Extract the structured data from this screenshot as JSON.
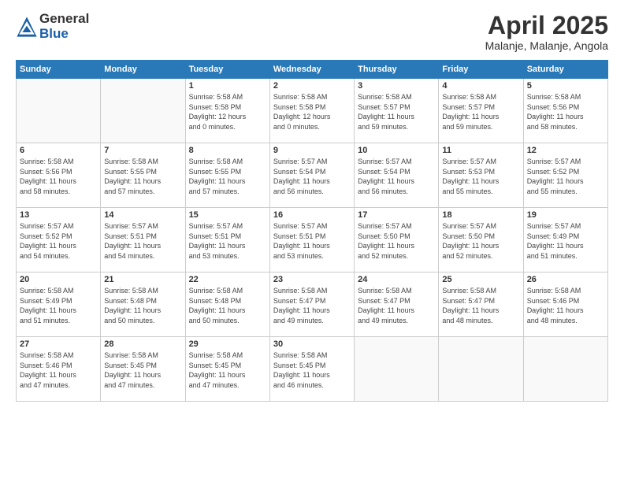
{
  "logo": {
    "general": "General",
    "blue": "Blue"
  },
  "title": "April 2025",
  "subtitle": "Malanje, Malanje, Angola",
  "days_header": [
    "Sunday",
    "Monday",
    "Tuesday",
    "Wednesday",
    "Thursday",
    "Friday",
    "Saturday"
  ],
  "weeks": [
    [
      {
        "day": "",
        "info": ""
      },
      {
        "day": "",
        "info": ""
      },
      {
        "day": "1",
        "info": "Sunrise: 5:58 AM\nSunset: 5:58 PM\nDaylight: 12 hours\nand 0 minutes."
      },
      {
        "day": "2",
        "info": "Sunrise: 5:58 AM\nSunset: 5:58 PM\nDaylight: 12 hours\nand 0 minutes."
      },
      {
        "day": "3",
        "info": "Sunrise: 5:58 AM\nSunset: 5:57 PM\nDaylight: 11 hours\nand 59 minutes."
      },
      {
        "day": "4",
        "info": "Sunrise: 5:58 AM\nSunset: 5:57 PM\nDaylight: 11 hours\nand 59 minutes."
      },
      {
        "day": "5",
        "info": "Sunrise: 5:58 AM\nSunset: 5:56 PM\nDaylight: 11 hours\nand 58 minutes."
      }
    ],
    [
      {
        "day": "6",
        "info": "Sunrise: 5:58 AM\nSunset: 5:56 PM\nDaylight: 11 hours\nand 58 minutes."
      },
      {
        "day": "7",
        "info": "Sunrise: 5:58 AM\nSunset: 5:55 PM\nDaylight: 11 hours\nand 57 minutes."
      },
      {
        "day": "8",
        "info": "Sunrise: 5:58 AM\nSunset: 5:55 PM\nDaylight: 11 hours\nand 57 minutes."
      },
      {
        "day": "9",
        "info": "Sunrise: 5:57 AM\nSunset: 5:54 PM\nDaylight: 11 hours\nand 56 minutes."
      },
      {
        "day": "10",
        "info": "Sunrise: 5:57 AM\nSunset: 5:54 PM\nDaylight: 11 hours\nand 56 minutes."
      },
      {
        "day": "11",
        "info": "Sunrise: 5:57 AM\nSunset: 5:53 PM\nDaylight: 11 hours\nand 55 minutes."
      },
      {
        "day": "12",
        "info": "Sunrise: 5:57 AM\nSunset: 5:52 PM\nDaylight: 11 hours\nand 55 minutes."
      }
    ],
    [
      {
        "day": "13",
        "info": "Sunrise: 5:57 AM\nSunset: 5:52 PM\nDaylight: 11 hours\nand 54 minutes."
      },
      {
        "day": "14",
        "info": "Sunrise: 5:57 AM\nSunset: 5:51 PM\nDaylight: 11 hours\nand 54 minutes."
      },
      {
        "day": "15",
        "info": "Sunrise: 5:57 AM\nSunset: 5:51 PM\nDaylight: 11 hours\nand 53 minutes."
      },
      {
        "day": "16",
        "info": "Sunrise: 5:57 AM\nSunset: 5:51 PM\nDaylight: 11 hours\nand 53 minutes."
      },
      {
        "day": "17",
        "info": "Sunrise: 5:57 AM\nSunset: 5:50 PM\nDaylight: 11 hours\nand 52 minutes."
      },
      {
        "day": "18",
        "info": "Sunrise: 5:57 AM\nSunset: 5:50 PM\nDaylight: 11 hours\nand 52 minutes."
      },
      {
        "day": "19",
        "info": "Sunrise: 5:57 AM\nSunset: 5:49 PM\nDaylight: 11 hours\nand 51 minutes."
      }
    ],
    [
      {
        "day": "20",
        "info": "Sunrise: 5:58 AM\nSunset: 5:49 PM\nDaylight: 11 hours\nand 51 minutes."
      },
      {
        "day": "21",
        "info": "Sunrise: 5:58 AM\nSunset: 5:48 PM\nDaylight: 11 hours\nand 50 minutes."
      },
      {
        "day": "22",
        "info": "Sunrise: 5:58 AM\nSunset: 5:48 PM\nDaylight: 11 hours\nand 50 minutes."
      },
      {
        "day": "23",
        "info": "Sunrise: 5:58 AM\nSunset: 5:47 PM\nDaylight: 11 hours\nand 49 minutes."
      },
      {
        "day": "24",
        "info": "Sunrise: 5:58 AM\nSunset: 5:47 PM\nDaylight: 11 hours\nand 49 minutes."
      },
      {
        "day": "25",
        "info": "Sunrise: 5:58 AM\nSunset: 5:47 PM\nDaylight: 11 hours\nand 48 minutes."
      },
      {
        "day": "26",
        "info": "Sunrise: 5:58 AM\nSunset: 5:46 PM\nDaylight: 11 hours\nand 48 minutes."
      }
    ],
    [
      {
        "day": "27",
        "info": "Sunrise: 5:58 AM\nSunset: 5:46 PM\nDaylight: 11 hours\nand 47 minutes."
      },
      {
        "day": "28",
        "info": "Sunrise: 5:58 AM\nSunset: 5:45 PM\nDaylight: 11 hours\nand 47 minutes."
      },
      {
        "day": "29",
        "info": "Sunrise: 5:58 AM\nSunset: 5:45 PM\nDaylight: 11 hours\nand 47 minutes."
      },
      {
        "day": "30",
        "info": "Sunrise: 5:58 AM\nSunset: 5:45 PM\nDaylight: 11 hours\nand 46 minutes."
      },
      {
        "day": "",
        "info": ""
      },
      {
        "day": "",
        "info": ""
      },
      {
        "day": "",
        "info": ""
      }
    ]
  ]
}
